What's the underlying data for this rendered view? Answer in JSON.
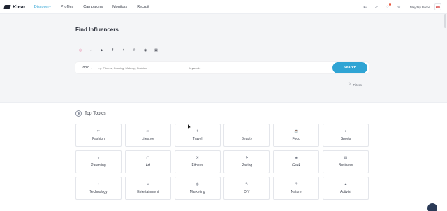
{
  "app": {
    "name": "Klear"
  },
  "nav": {
    "links": [
      {
        "label": "Discovery",
        "active": true
      },
      {
        "label": "Profiles",
        "active": false
      },
      {
        "label": "Campaigns",
        "active": false
      },
      {
        "label": "Monitors",
        "active": false
      },
      {
        "label": "Recruit",
        "active": false
      }
    ],
    "user_name": "Mayday Borne",
    "avatar_text": "HD"
  },
  "hero": {
    "title": "Find Influencers",
    "socials": [
      {
        "icon": "instagram-icon",
        "glyph": "◎",
        "active": true
      },
      {
        "icon": "tiktok-icon",
        "glyph": "♪",
        "active": false
      },
      {
        "icon": "youtube-icon",
        "glyph": "▶",
        "active": false
      },
      {
        "icon": "facebook-icon",
        "glyph": "f",
        "active": false
      },
      {
        "icon": "twitter-icon",
        "glyph": "✦",
        "active": false
      },
      {
        "icon": "pinterest-icon",
        "glyph": "℗",
        "active": false
      },
      {
        "icon": "rss-icon",
        "glyph": "◉",
        "active": false
      },
      {
        "icon": "twitch-icon",
        "glyph": "▣",
        "active": false
      }
    ],
    "search": {
      "topic_label": "Topic",
      "topic_placeholder": "e.g. Fitness, Cooking, Makeup, Fashion",
      "secondary_placeholder": "Keywords",
      "location_label": "Location",
      "button_label": "Search"
    },
    "filters_label": "Filters"
  },
  "topics": {
    "title": "Top Topics",
    "items": [
      {
        "label": "Fashion",
        "glyph": "✂"
      },
      {
        "label": "Lifestyle",
        "glyph": "▭"
      },
      {
        "label": "Travel",
        "glyph": "✈"
      },
      {
        "label": "Beauty",
        "glyph": "◔"
      },
      {
        "label": "Food",
        "glyph": "☕"
      },
      {
        "label": "Sports",
        "glyph": "●"
      },
      {
        "label": "Parenting",
        "glyph": "◒"
      },
      {
        "label": "Art",
        "glyph": "▢"
      },
      {
        "label": "Fitness",
        "glyph": "⚒"
      },
      {
        "label": "Racing",
        "glyph": "⚑"
      },
      {
        "label": "Geek",
        "glyph": "◈"
      },
      {
        "label": "Business",
        "glyph": "▤"
      },
      {
        "label": "Technology",
        "glyph": "▪"
      },
      {
        "label": "Entertainment",
        "glyph": "☺"
      },
      {
        "label": "Marketing",
        "glyph": "◍"
      },
      {
        "label": "DIY",
        "glyph": "✎"
      },
      {
        "label": "Nature",
        "glyph": "⚘"
      },
      {
        "label": "Activist",
        "glyph": "▲"
      }
    ]
  },
  "colors": {
    "accent": "#2fa4d4",
    "hero_bg": "#f4f5f7"
  }
}
